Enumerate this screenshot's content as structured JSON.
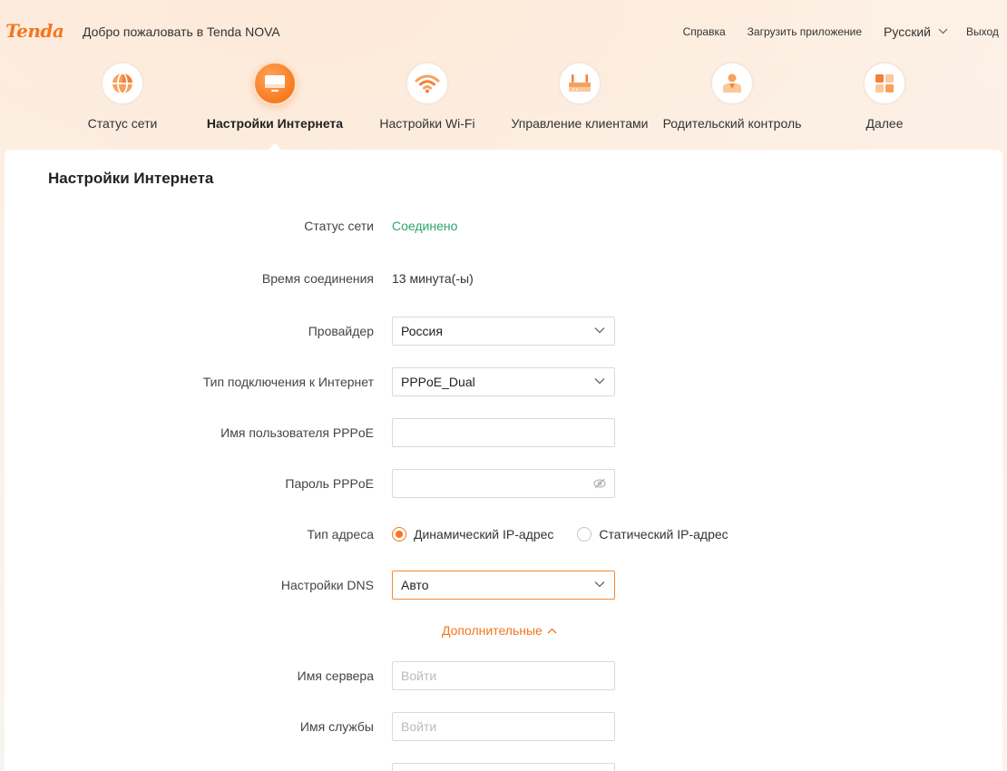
{
  "header": {
    "logo": "Tenda",
    "welcome": "Добро пожаловать в Tenda NOVA",
    "help": "Справка",
    "download_app": "Загрузить приложение",
    "language": "Русский",
    "exit": "Выход"
  },
  "nav": {
    "items": [
      {
        "label": "Статус сети",
        "icon": "globe-icon"
      },
      {
        "label": "Настройки Интернета",
        "icon": "monitor-icon",
        "active": true
      },
      {
        "label": "Настройки Wi-Fi",
        "icon": "wifi-icon"
      },
      {
        "label": "Управление клиентами",
        "icon": "router-icon"
      },
      {
        "label": "Родительский контроль",
        "icon": "parent-user-icon"
      },
      {
        "label": "Далее",
        "icon": "grid-icon"
      }
    ]
  },
  "panel": {
    "title": "Настройки Интернета",
    "status_label": "Статус сети",
    "status_value": "Соединено",
    "time_label": "Время соединения",
    "time_value": "13 минута(-ы)",
    "provider_label": "Провайдер",
    "provider_value": "Россия",
    "conn_type_label": "Тип подключения к Интернет",
    "conn_type_value": "PPPoE_Dual",
    "username_label": "Имя пользователя PPPoE",
    "username_value": "",
    "password_label": "Пароль PPPoE",
    "password_value": "",
    "addr_type_label": "Тип адреса",
    "addr_dynamic": "Динамический IP-адрес",
    "addr_static": "Статический IP-адрес",
    "dns_label": "Настройки DNS",
    "dns_value": "Авто",
    "advanced_toggle": "Дополнительные",
    "server_name_label": "Имя сервера",
    "server_name_placeholder": "Войти",
    "service_name_label": "Имя службы",
    "service_name_placeholder": "Войти"
  },
  "colors": {
    "accent": "#f5751e",
    "status_ok": "#2aa56e"
  }
}
